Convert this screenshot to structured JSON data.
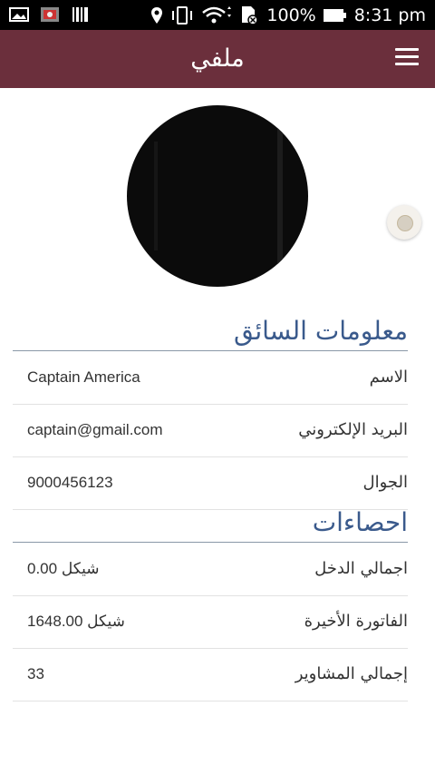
{
  "status_bar": {
    "battery": "100%",
    "time": "8:31 pm"
  },
  "app_bar": {
    "title": "ملفي"
  },
  "profile": {
    "avatar_alt": "",
    "driver_section": {
      "heading": "معلومات السائق",
      "rows": [
        {
          "label": "الاسم",
          "value": "Captain America"
        },
        {
          "label": "البريد الإلكتروني",
          "value": "captain@gmail.com"
        },
        {
          "label": "الجوال",
          "value": "9000456123"
        }
      ]
    },
    "stats_section": {
      "heading": "احصاءات",
      "rows": [
        {
          "label": "اجمالي الدخل",
          "value": "شيكل 0.00"
        },
        {
          "label": "الفاتورة الأخيرة",
          "value": "شيكل 1648.00"
        },
        {
          "label": "إجمالي المشاوير",
          "value": "33"
        }
      ]
    }
  },
  "colors": {
    "app_bar": "#6b2f3c",
    "section_heading": "#3a5a8c"
  }
}
